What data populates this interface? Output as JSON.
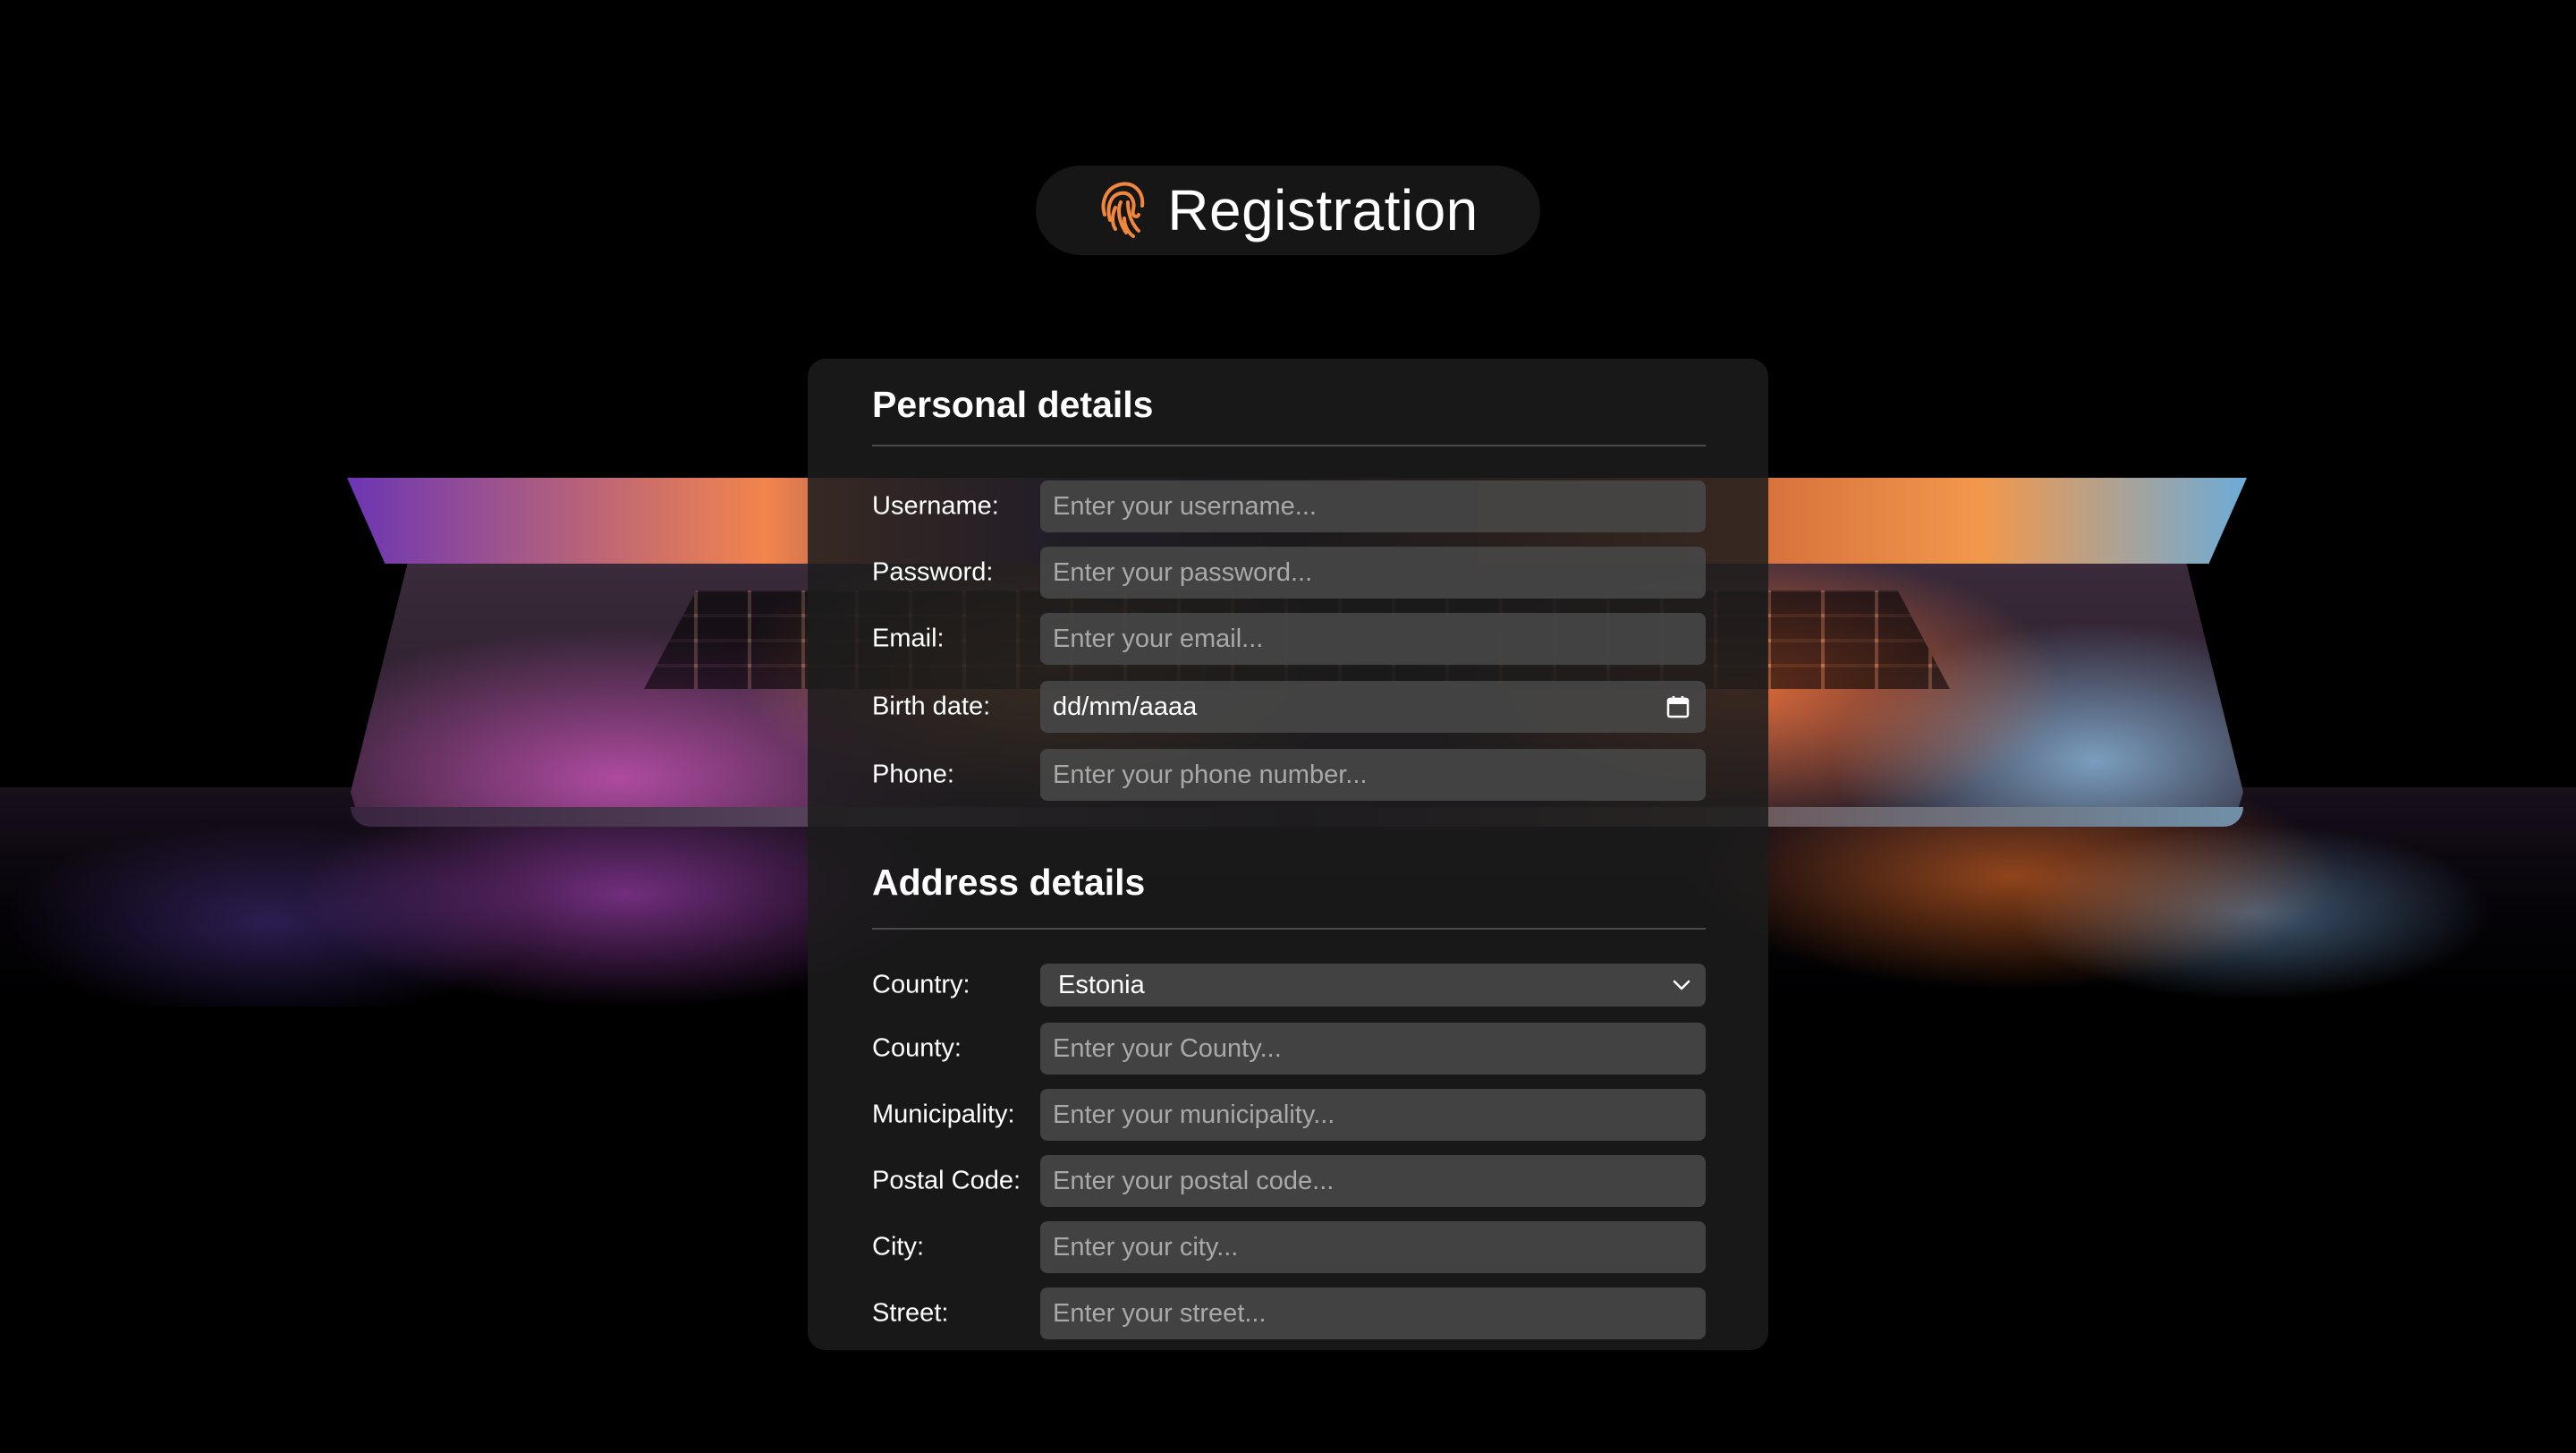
{
  "header": {
    "title": "Registration",
    "icon": "fingerprint-icon",
    "accent_color": "#f0873c"
  },
  "personal": {
    "section_title": "Personal details",
    "username": {
      "label": "Username:",
      "placeholder": "Enter your username..."
    },
    "password": {
      "label": "Password:",
      "placeholder": "Enter your password..."
    },
    "email": {
      "label": "Email:",
      "placeholder": "Enter your email..."
    },
    "birth_date": {
      "label": "Birth date:",
      "value": "dd/mm/aaaa",
      "icon": "calendar-icon"
    },
    "phone": {
      "label": "Phone:",
      "placeholder": "Enter your phone number..."
    }
  },
  "address": {
    "section_title": "Address details",
    "country": {
      "label": "Country:",
      "value": "Estonia",
      "icon": "chevron-down-icon"
    },
    "county": {
      "label": "County:",
      "placeholder": "Enter your County..."
    },
    "municipality": {
      "label": "Municipality:",
      "placeholder": "Enter your municipality..."
    },
    "postal_code": {
      "label": "Postal Code:",
      "placeholder": "Enter your postal code..."
    },
    "city": {
      "label": "City:",
      "placeholder": "Enter your city..."
    },
    "street": {
      "label": "Street:",
      "placeholder": "Enter your street..."
    }
  }
}
